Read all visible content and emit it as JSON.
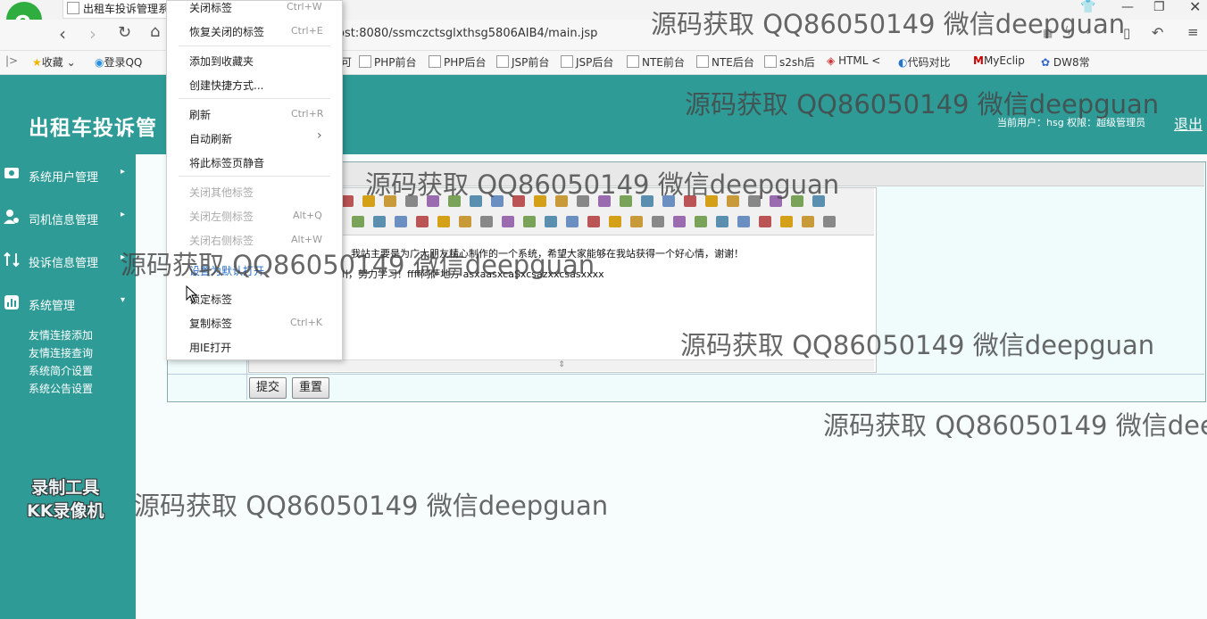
{
  "browser": {
    "tab_title": "出租车投诉管理系",
    "address": "ost:8080/ssmczctsglxthsg5806AIB4/main.jsp",
    "bookmarks": [
      "收藏",
      "登录QQ",
      "可",
      "PHP前台",
      "PHP后台",
      "JSP前台",
      "JSP后台",
      "NTE前台",
      "NTE后台",
      "s2sh后",
      "HTML <",
      "代码对比",
      "MyEclip",
      "DW8常"
    ]
  },
  "context_menu": {
    "items": [
      {
        "label": "关闭标签",
        "shortcut": "Ctrl+W"
      },
      {
        "label": "恢复关闭的标签",
        "shortcut": "Ctrl+E"
      },
      {
        "label": "添加到收藏夹",
        "shortcut": ""
      },
      {
        "label": "创建快捷方式...",
        "shortcut": ""
      },
      {
        "label": "刷新",
        "shortcut": "Ctrl+R"
      },
      {
        "label": "自动刷新",
        "shortcut": ""
      },
      {
        "label": "将此标签页静音",
        "shortcut": ""
      },
      {
        "label": "关闭其他标签",
        "shortcut": ""
      },
      {
        "label": "关闭左侧标签",
        "shortcut": "Alt+Q"
      },
      {
        "label": "关闭右侧标签",
        "shortcut": "Alt+W"
      },
      {
        "label": "设置为默认打开",
        "shortcut": ""
      },
      {
        "label": "锁定标签",
        "shortcut": ""
      },
      {
        "label": "复制标签",
        "shortcut": "Ctrl+K"
      },
      {
        "label": "用IE打开",
        "shortcut": ""
      }
    ]
  },
  "header": {
    "title": "出租车投诉管",
    "user_info": "当前用户：hsg 权限：超级管理员",
    "logout": "退出"
  },
  "sidebar": {
    "items": [
      {
        "label": "系统用户管理"
      },
      {
        "label": "司机信息管理"
      },
      {
        "label": "投诉信息管理"
      },
      {
        "label": "系统管理"
      }
    ],
    "subitems": [
      "友情连接添加",
      "友情连接查询",
      "系统简介设置",
      "系统公告设置"
    ]
  },
  "editor": {
    "line1": "我站主要是为广大朋友精心制作的一个系统，希望大家能够在我站获得一个好心情，谢谢！",
    "line2": "川，努力学习！ffff阿萨地方 asxaasxcaSxcsazxxcsasxxxx",
    "resize_glyph": "⇕"
  },
  "buttons": {
    "submit": "提交",
    "reset": "重置"
  },
  "watermark": {
    "text": "源码获取 QQ86050149 微信deepguan",
    "recorder_line1": "录制工具",
    "recorder_line2": "KK录像机"
  }
}
